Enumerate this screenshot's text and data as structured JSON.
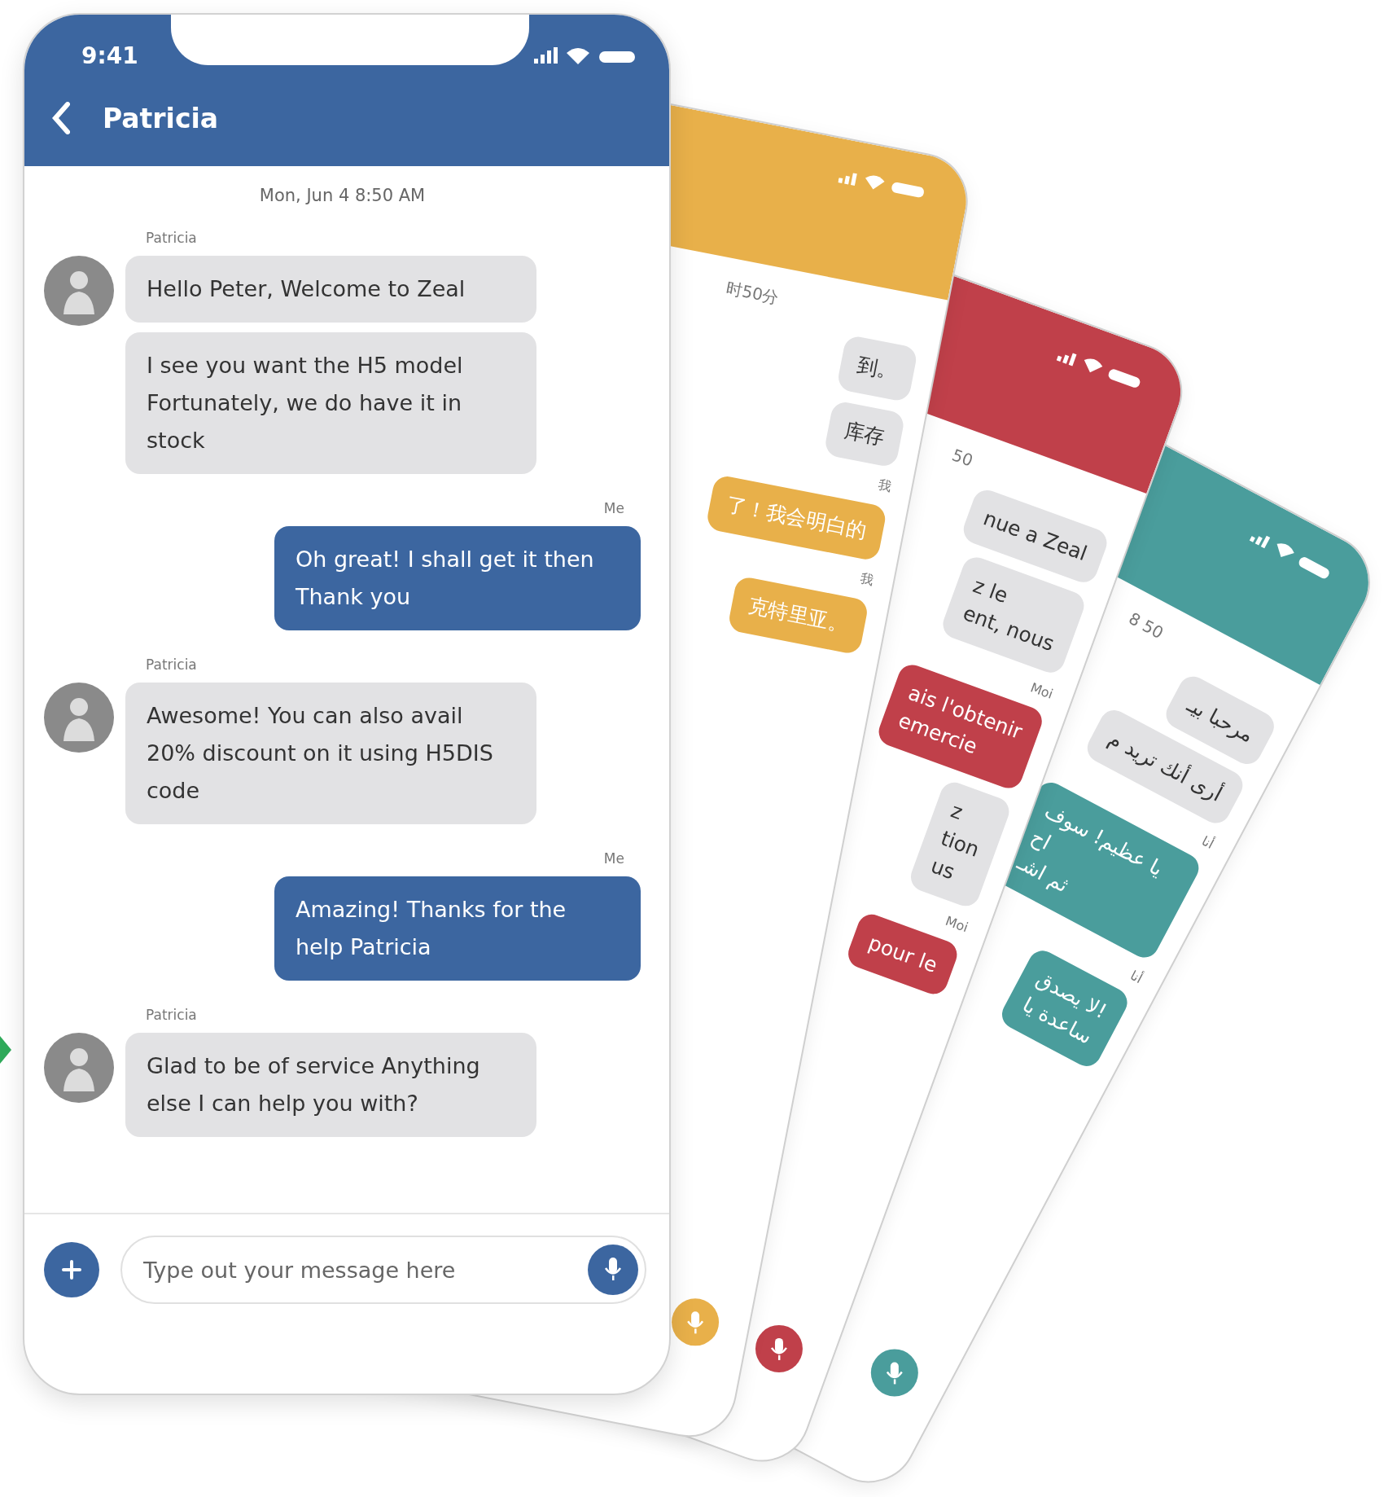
{
  "main_phone": {
    "status_bar": {
      "time": "9:41"
    },
    "header": {
      "title": "Patricia"
    },
    "date": "Mon, Jun 4 8:50 AM",
    "messages": [
      {
        "kind": "in",
        "sender": "Patricia",
        "bubbles": [
          "Hello Peter, Welcome to Zeal",
          "I see you want the H5 model Fortunately, we do have it in stock"
        ]
      },
      {
        "kind": "out",
        "sender": "Me",
        "bubbles": [
          "Oh great! I shall get it then  Thank you"
        ]
      },
      {
        "kind": "in",
        "sender": "Patricia",
        "bubbles": [
          "Awesome! You can also avail 20% discount on it using H5DIS code"
        ]
      },
      {
        "kind": "out",
        "sender": "Me",
        "bubbles": [
          "Amazing! Thanks for the help Patricia"
        ]
      },
      {
        "kind": "in",
        "sender": "Patricia",
        "bubbles": [
          "Glad to be of service Anything else I can help you with?"
        ]
      }
    ],
    "composer": {
      "placeholder": "Type out your message here"
    }
  },
  "back_phones": [
    {
      "color": "#e8b04a",
      "items": [
        {
          "kind": "date",
          "text": "时50分"
        },
        {
          "kind": "in",
          "text": "到。"
        },
        {
          "kind": "in",
          "text": "库存"
        },
        {
          "kind": "label",
          "text": "我"
        },
        {
          "kind": "out",
          "text": "了！我会明白的"
        },
        {
          "kind": "label",
          "text": "我"
        },
        {
          "kind": "out",
          "text": "克特里亚。"
        }
      ]
    },
    {
      "color": "#c0404a",
      "items": [
        {
          "kind": "date",
          "text": "50"
        },
        {
          "kind": "in",
          "text": "nue a Zeal"
        },
        {
          "kind": "in",
          "text": "z le\nent, nous"
        },
        {
          "kind": "label",
          "text": "Moi"
        },
        {
          "kind": "out",
          "text": "ais l'obtenir\nemercie"
        },
        {
          "kind": "in",
          "text": "z\ntion\nus"
        },
        {
          "kind": "label",
          "text": "Moi"
        },
        {
          "kind": "out",
          "text": "pour le"
        }
      ]
    },
    {
      "color": "#4a9d9c",
      "items": [
        {
          "kind": "date",
          "text": "8 50"
        },
        {
          "kind": "in",
          "text": "مرحبا بيـ"
        },
        {
          "kind": "in",
          "text": "أرى أنك تريد م"
        },
        {
          "kind": "label",
          "text": "أنا"
        },
        {
          "kind": "out",
          "text": "يا عظيم! سوف اح\nثم اشـ"
        },
        {
          "kind": "label",
          "text": "أنا"
        },
        {
          "kind": "out",
          "text": "لا يصدق!\nساعدة يا"
        }
      ]
    }
  ]
}
